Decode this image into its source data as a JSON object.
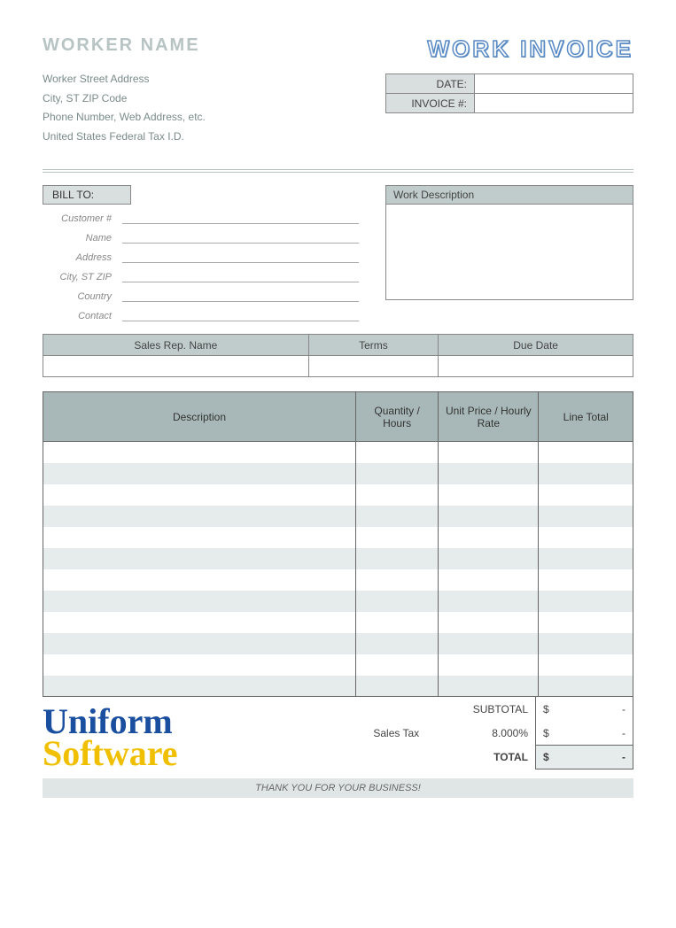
{
  "header": {
    "worker_name": "WORKER NAME",
    "title": "WORK INVOICE"
  },
  "address": {
    "street": "Worker Street Address",
    "city_line": "City, ST  ZIP Code",
    "phone_line": "Phone Number, Web Address, etc.",
    "tax_id": "United States Federal Tax I.D."
  },
  "meta": {
    "date_label": "DATE:",
    "date_value": "",
    "invoice_label": "INVOICE #:",
    "invoice_value": ""
  },
  "bill_to": {
    "header": "BILL TO:",
    "fields": {
      "customer_no": "Customer #",
      "name": "Name",
      "address": "Address",
      "city": "City, ST ZIP",
      "country": "Country",
      "contact": "Contact"
    }
  },
  "work_description": {
    "header": "Work Description",
    "body": ""
  },
  "terms": {
    "sales_rep": "Sales Rep. Name",
    "terms": "Terms",
    "due_date": "Due Date",
    "sales_rep_value": "",
    "terms_value": "",
    "due_date_value": ""
  },
  "items": {
    "col_desc": "Description",
    "col_qty": "Quantity / Hours",
    "col_rate": "Unit Price / Hourly Rate",
    "col_total": "Line Total"
  },
  "totals": {
    "subtotal_label": "SUBTOTAL",
    "subtotal_value": "-",
    "tax_name": "Sales Tax",
    "tax_rate": "8.000%",
    "tax_value": "-",
    "total_label": "TOTAL",
    "total_value": "-",
    "currency": "$"
  },
  "logo": {
    "line1": "Uniform",
    "line2": "Software"
  },
  "footer": "THANK YOU FOR YOUR BUSINESS!"
}
